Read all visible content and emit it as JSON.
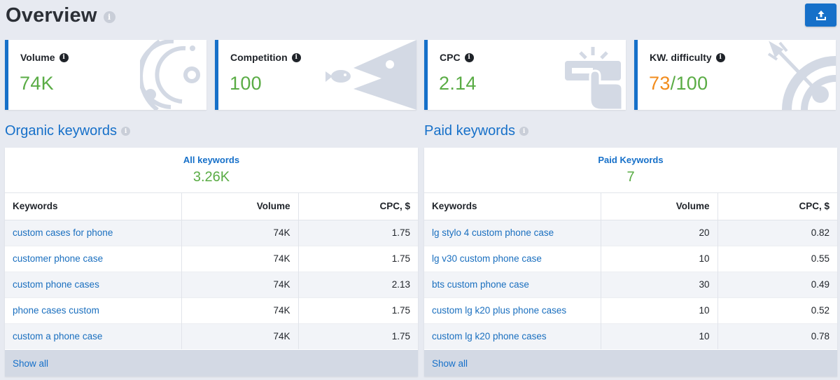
{
  "page": {
    "title": "Overview"
  },
  "export": {
    "icon": "upload-icon"
  },
  "cards": [
    {
      "label": "Volume",
      "value": "74K",
      "icon": "target-circles-icon"
    },
    {
      "label": "Competition",
      "value": "100",
      "icon": "fish-icon"
    },
    {
      "label": "CPC",
      "value": "2.14",
      "icon": "hand-click-icon"
    },
    {
      "label": "KW. difficulty",
      "value_main": "73",
      "value_rest": "/100",
      "icon": "dart-target-icon"
    }
  ],
  "organic": {
    "title": "Organic keywords",
    "head_label": "All keywords",
    "head_value": "3.26K",
    "columns": [
      "Keywords",
      "Volume",
      "CPC, $"
    ],
    "rows": [
      [
        "custom cases for phone",
        "74K",
        "1.75"
      ],
      [
        "customer phone case",
        "74K",
        "1.75"
      ],
      [
        "custom phone cases",
        "74K",
        "2.13"
      ],
      [
        "phone cases custom",
        "74K",
        "1.75"
      ],
      [
        "custom a phone case",
        "74K",
        "1.75"
      ]
    ],
    "show_all": "Show all"
  },
  "paid": {
    "title": "Paid keywords",
    "head_label": "Paid Keywords",
    "head_value": "7",
    "columns": [
      "Keywords",
      "Volume",
      "CPC, $"
    ],
    "rows": [
      [
        "lg stylo 4 custom phone case",
        "20",
        "0.82"
      ],
      [
        "lg v30 custom phone case",
        "10",
        "0.55"
      ],
      [
        "bts custom phone case",
        "30",
        "0.49"
      ],
      [
        "custom lg k20 plus phone cases",
        "10",
        "0.52"
      ],
      [
        "custom lg k20 phone cases",
        "10",
        "0.78"
      ]
    ],
    "show_all": "Show all"
  },
  "colors": {
    "accent": "#1670c9",
    "positive": "#5aac45",
    "warning": "#f28c1d"
  }
}
